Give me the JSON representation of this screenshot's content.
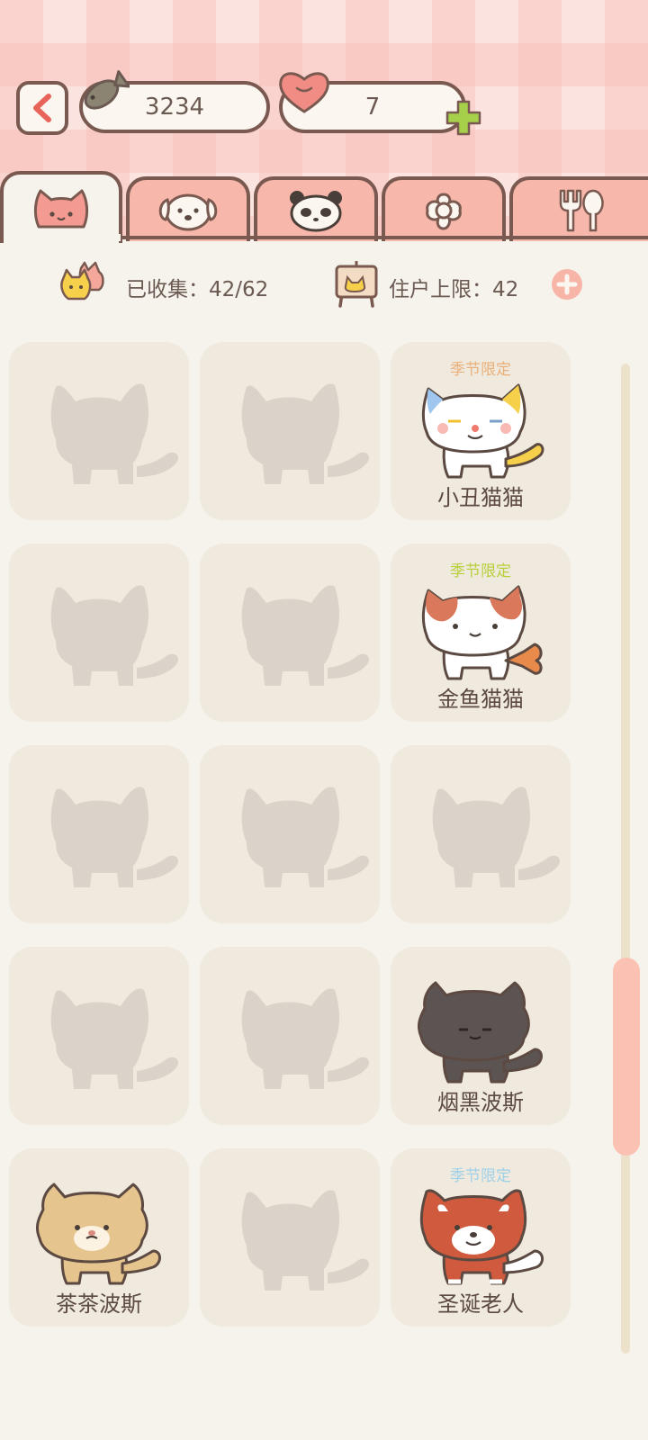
{
  "header": {
    "coins": "3234",
    "hearts": "7"
  },
  "tabs": [
    {
      "icon": "cat-face-icon",
      "active": true
    },
    {
      "icon": "dog-face-icon",
      "active": false
    },
    {
      "icon": "panda-face-icon",
      "active": false
    },
    {
      "icon": "flower-icon",
      "active": false
    },
    {
      "icon": "fork-spoon-icon",
      "active": false
    }
  ],
  "stats": {
    "collected_label": "已收集：42/62",
    "capacity_label": "住户上限：42"
  },
  "grid": {
    "cells": [
      {
        "unlocked": false
      },
      {
        "unlocked": false
      },
      {
        "unlocked": true,
        "badge": "季节限定",
        "badge_color": "#eab07a",
        "name": "小丑猫猫"
      },
      {
        "unlocked": false
      },
      {
        "unlocked": false
      },
      {
        "unlocked": true,
        "badge": "季节限定",
        "badge_color": "#b8cf3a",
        "name": "金鱼猫猫"
      },
      {
        "unlocked": false
      },
      {
        "unlocked": false
      },
      {
        "unlocked": false
      },
      {
        "unlocked": false
      },
      {
        "unlocked": false
      },
      {
        "unlocked": true,
        "name": "烟黑波斯"
      },
      {
        "unlocked": true,
        "name": "茶茶波斯"
      },
      {
        "unlocked": false
      },
      {
        "unlocked": true,
        "badge": "季节限定",
        "badge_color": "#9fd0e8",
        "name": "圣诞老人"
      }
    ]
  },
  "colors": {
    "outline": "#7a5a50",
    "tab_inactive": "#f7b7aa",
    "cell_bg": "#efe9de",
    "silhouette": "#d8d2c8",
    "scroll_thumb": "#fbc2b4"
  }
}
